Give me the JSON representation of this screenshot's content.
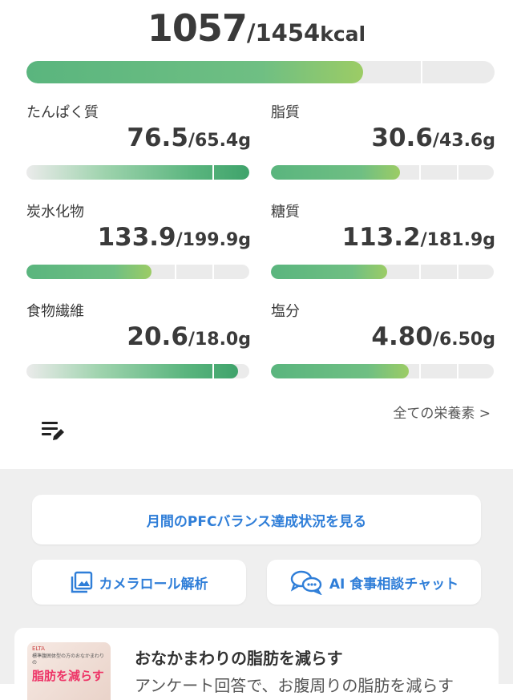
{
  "calories": {
    "current": "1057",
    "target": "/1454",
    "unit": "kcal",
    "progress": 0.72
  },
  "nutrients": [
    {
      "name": "たんぱく質",
      "current": "76.5",
      "target": "/65.4g",
      "progress": 1.0,
      "style": "fade"
    },
    {
      "name": "脂質",
      "current": "30.6",
      "target": "/43.6g",
      "progress": 0.58,
      "style": "std"
    },
    {
      "name": "炭水化物",
      "current": "133.9",
      "target": "/199.9g",
      "progress": 0.56,
      "style": "std"
    },
    {
      "name": "糖質",
      "current": "113.2",
      "target": "/181.9g",
      "progress": 0.52,
      "style": "std"
    },
    {
      "name": "食物繊維",
      "current": "20.6",
      "target": "/18.0g",
      "progress": 1.0,
      "style": "fade"
    },
    {
      "name": "塩分",
      "current": "4.80",
      "target": "/6.50g",
      "progress": 0.62,
      "style": "std"
    }
  ],
  "all_nutrients_link": "全ての栄養素 >",
  "icons": {
    "edit": "edit-list-icon",
    "camera_roll": "image-gallery-icon",
    "chat": "chat-bubbles-icon"
  },
  "buttons": {
    "pfc_balance": "月間のPFCバランス達成状況を見る",
    "camera_roll": "カメラロール解析",
    "ai_chat": "AI 食事相談チャット"
  },
  "ad": {
    "thumb_brand": "ELTA",
    "thumb_caption": "標準腹囲体型の方のおなかまわりの",
    "thumb_headline": "脂肪を減らす",
    "title": "おなかまわりの脂肪を減らす",
    "description": "アンケート回答で、お腹周りの脂肪を減らす"
  },
  "colors": {
    "accent": "#2f7ed8",
    "bar_green": "#5ab57e",
    "bar_bg": "#ebebeb"
  }
}
